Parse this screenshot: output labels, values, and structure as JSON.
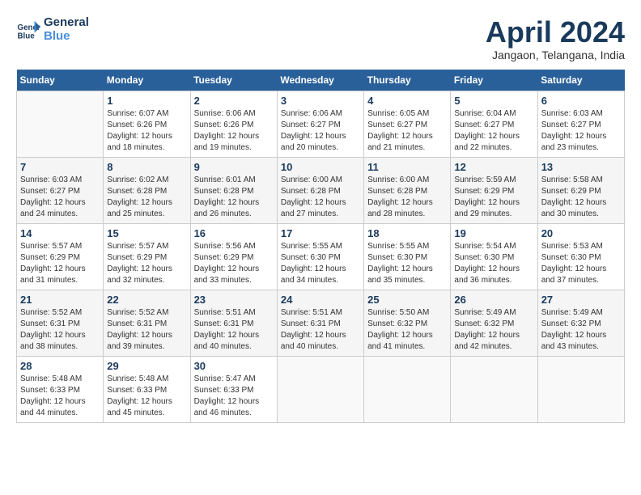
{
  "header": {
    "logo_line1": "General",
    "logo_line2": "Blue",
    "month_title": "April 2024",
    "location": "Jangaon, Telangana, India"
  },
  "days_of_week": [
    "Sunday",
    "Monday",
    "Tuesday",
    "Wednesday",
    "Thursday",
    "Friday",
    "Saturday"
  ],
  "weeks": [
    [
      {
        "day": null,
        "info": null
      },
      {
        "day": "1",
        "rise": "6:07 AM",
        "set": "6:26 PM",
        "daylight": "12 hours and 18 minutes."
      },
      {
        "day": "2",
        "rise": "6:06 AM",
        "set": "6:26 PM",
        "daylight": "12 hours and 19 minutes."
      },
      {
        "day": "3",
        "rise": "6:06 AM",
        "set": "6:27 PM",
        "daylight": "12 hours and 20 minutes."
      },
      {
        "day": "4",
        "rise": "6:05 AM",
        "set": "6:27 PM",
        "daylight": "12 hours and 21 minutes."
      },
      {
        "day": "5",
        "rise": "6:04 AM",
        "set": "6:27 PM",
        "daylight": "12 hours and 22 minutes."
      },
      {
        "day": "6",
        "rise": "6:03 AM",
        "set": "6:27 PM",
        "daylight": "12 hours and 23 minutes."
      }
    ],
    [
      {
        "day": "7",
        "rise": "6:03 AM",
        "set": "6:27 PM",
        "daylight": "12 hours and 24 minutes."
      },
      {
        "day": "8",
        "rise": "6:02 AM",
        "set": "6:28 PM",
        "daylight": "12 hours and 25 minutes."
      },
      {
        "day": "9",
        "rise": "6:01 AM",
        "set": "6:28 PM",
        "daylight": "12 hours and 26 minutes."
      },
      {
        "day": "10",
        "rise": "6:00 AM",
        "set": "6:28 PM",
        "daylight": "12 hours and 27 minutes."
      },
      {
        "day": "11",
        "rise": "6:00 AM",
        "set": "6:28 PM",
        "daylight": "12 hours and 28 minutes."
      },
      {
        "day": "12",
        "rise": "5:59 AM",
        "set": "6:29 PM",
        "daylight": "12 hours and 29 minutes."
      },
      {
        "day": "13",
        "rise": "5:58 AM",
        "set": "6:29 PM",
        "daylight": "12 hours and 30 minutes."
      }
    ],
    [
      {
        "day": "14",
        "rise": "5:57 AM",
        "set": "6:29 PM",
        "daylight": "12 hours and 31 minutes."
      },
      {
        "day": "15",
        "rise": "5:57 AM",
        "set": "6:29 PM",
        "daylight": "12 hours and 32 minutes."
      },
      {
        "day": "16",
        "rise": "5:56 AM",
        "set": "6:29 PM",
        "daylight": "12 hours and 33 minutes."
      },
      {
        "day": "17",
        "rise": "5:55 AM",
        "set": "6:30 PM",
        "daylight": "12 hours and 34 minutes."
      },
      {
        "day": "18",
        "rise": "5:55 AM",
        "set": "6:30 PM",
        "daylight": "12 hours and 35 minutes."
      },
      {
        "day": "19",
        "rise": "5:54 AM",
        "set": "6:30 PM",
        "daylight": "12 hours and 36 minutes."
      },
      {
        "day": "20",
        "rise": "5:53 AM",
        "set": "6:30 PM",
        "daylight": "12 hours and 37 minutes."
      }
    ],
    [
      {
        "day": "21",
        "rise": "5:52 AM",
        "set": "6:31 PM",
        "daylight": "12 hours and 38 minutes."
      },
      {
        "day": "22",
        "rise": "5:52 AM",
        "set": "6:31 PM",
        "daylight": "12 hours and 39 minutes."
      },
      {
        "day": "23",
        "rise": "5:51 AM",
        "set": "6:31 PM",
        "daylight": "12 hours and 40 minutes."
      },
      {
        "day": "24",
        "rise": "5:51 AM",
        "set": "6:31 PM",
        "daylight": "12 hours and 40 minutes."
      },
      {
        "day": "25",
        "rise": "5:50 AM",
        "set": "6:32 PM",
        "daylight": "12 hours and 41 minutes."
      },
      {
        "day": "26",
        "rise": "5:49 AM",
        "set": "6:32 PM",
        "daylight": "12 hours and 42 minutes."
      },
      {
        "day": "27",
        "rise": "5:49 AM",
        "set": "6:32 PM",
        "daylight": "12 hours and 43 minutes."
      }
    ],
    [
      {
        "day": "28",
        "rise": "5:48 AM",
        "set": "6:33 PM",
        "daylight": "12 hours and 44 minutes."
      },
      {
        "day": "29",
        "rise": "5:48 AM",
        "set": "6:33 PM",
        "daylight": "12 hours and 45 minutes."
      },
      {
        "day": "30",
        "rise": "5:47 AM",
        "set": "6:33 PM",
        "daylight": "12 hours and 46 minutes."
      },
      {
        "day": null,
        "info": null
      },
      {
        "day": null,
        "info": null
      },
      {
        "day": null,
        "info": null
      },
      {
        "day": null,
        "info": null
      }
    ]
  ],
  "labels": {
    "sunrise_prefix": "Sunrise: ",
    "sunset_prefix": "Sunset: ",
    "daylight_prefix": "Daylight: "
  }
}
